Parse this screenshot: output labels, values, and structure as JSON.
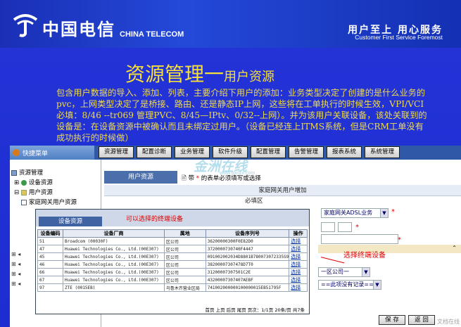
{
  "header": {
    "brand_cn": "中国电信",
    "brand_en": "CHINA TELECOM",
    "slogan_cn": "用户至上  用心服务",
    "slogan_en": "Customer First Service Foremost"
  },
  "slide": {
    "title_big": "资源管理一",
    "title_small": "用户资源",
    "description": "包含用户数据的导入、添加、列表，主要介绍下用户的添加：业务类型决定了创建的是什么业务的pvc，上网类型决定了是桥接、路由、还是静态IP上网，这些将在工单执行的时候生效，VPI/VCI必填：8/46 --tr069 管理PVC、8/45—IPtv、0/32--上网）。并为该用户关联设备，该处关联到的设备是：在设备资源中被确认而且未绑定过用户。（设备已经连上ITMS系统，但是CRM工单没有成功执行的时候做）"
  },
  "app": {
    "side_title": "快捷菜单",
    "menu": [
      "资源管理",
      "配置诊断",
      "业务管理",
      "软件升级",
      "配置管理",
      "告警管理",
      "报表系统",
      "系统管理"
    ],
    "tree": [
      "资源管理",
      "设备资源",
      "用户资源",
      "家庭网关用户资源"
    ],
    "tab_label": "用户资源",
    "hint_prefix": "带",
    "hint_star": "*",
    "hint_suffix": "的表单必须填写或选择",
    "form_title": "家庭网关用户增加",
    "section_label": "必填区",
    "business_select": "家庭网关ADSL业务",
    "area_select": "一区公司一",
    "record_select": "==此项没有记录==",
    "save_label": "保 存",
    "return_label": "返 回"
  },
  "popup": {
    "tab_label": "设备资源",
    "note": "可以选择的终端设备",
    "columns": [
      "设备编码",
      "设备厂商",
      "属地",
      "设备序列号",
      "操作"
    ],
    "rows": [
      [
        "51",
        "Broadcom (00030F)",
        "区公司",
        "36200000300F0E82D0",
        "选择"
      ],
      [
        "47",
        "Huawei Technologies Co., Ltd.(00E307)",
        "区公司",
        "3720000730740F4447",
        "选择"
      ],
      [
        "45",
        "Huawei Technologies Co., Ltd.(00E307)",
        "区公司",
        "091002002034D8801B780073072335S9",
        "选择"
      ],
      [
        "46",
        "Huawei Technologies Co., Ltd.(00E307)",
        "区公司",
        "38200007307478D7T0",
        "选择"
      ],
      [
        "66",
        "Huawei Technologies Co., Ltd.(00E307)",
        "区公司",
        "31200007307501C2E",
        "选择"
      ],
      [
        "67",
        "Huawei Technologies Co., Ltd.(00E307)",
        "区公司",
        "43200007307407AEBF",
        "选择"
      ],
      [
        "97",
        "ZTE (0015EB)",
        "乌鲁木齐营业区局",
        "741002000000100000015EB51795F",
        "选择"
      ]
    ],
    "pager": "首页 上页 后页 尾页  页次：1/1页  20条/页  共7条"
  },
  "annotation": "选择终端设备",
  "watermark": {
    "main": "金洲在线",
    "sub": "www.qxnzx.com"
  },
  "corner_mark": "文档在线",
  "colors": {
    "slide_bg": "#1f2ecf",
    "title_yellow": "#f7df3a",
    "menu_bar": "#2f58a6",
    "accent_red": "#dd0000"
  }
}
